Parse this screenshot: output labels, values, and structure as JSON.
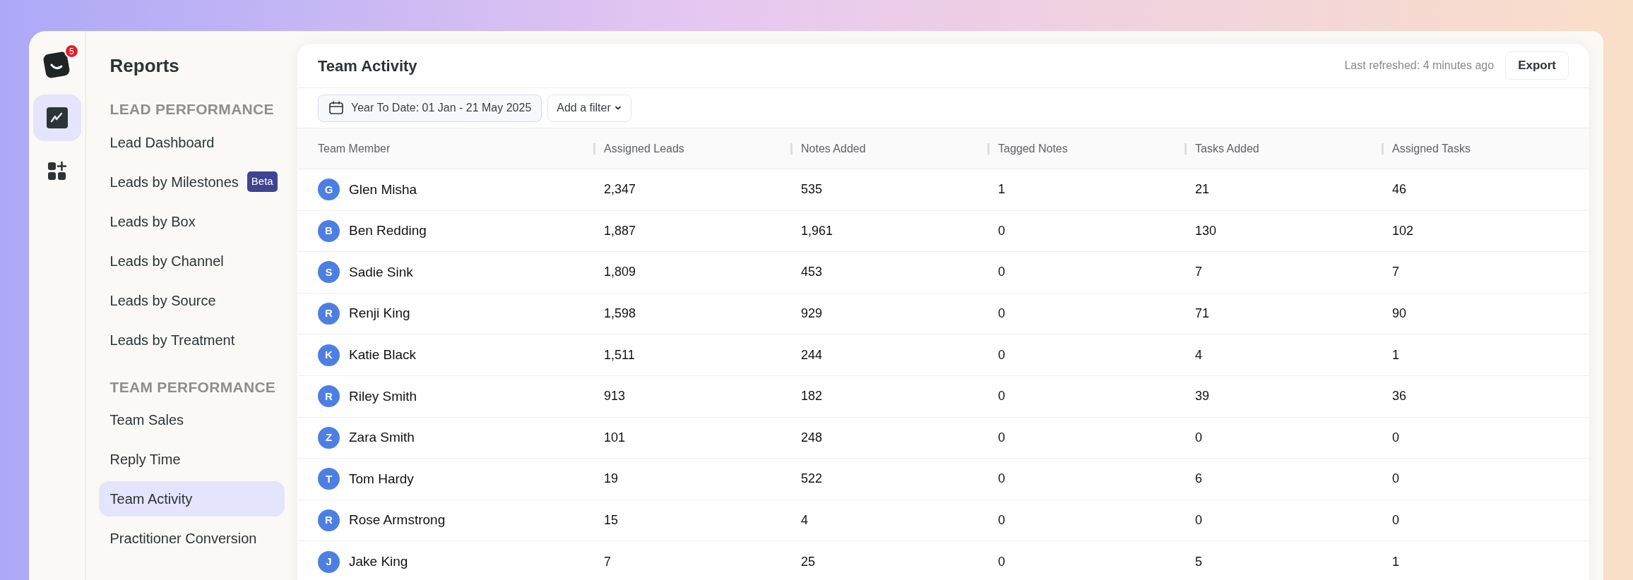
{
  "rail": {
    "logo_badge": "5",
    "items": [
      {
        "kind": "chart",
        "selected": true
      },
      {
        "kind": "apps",
        "selected": false
      }
    ]
  },
  "sidebar": {
    "title": "Reports",
    "sections": [
      {
        "heading": "LEAD PERFORMANCE",
        "items": [
          {
            "label": "Lead Dashboard",
            "selected": false
          },
          {
            "label": "Leads by Milestones",
            "badge": "Beta",
            "selected": false
          },
          {
            "label": "Leads by Box",
            "selected": false
          },
          {
            "label": "Leads by Channel",
            "selected": false
          },
          {
            "label": "Leads by Source",
            "selected": false
          },
          {
            "label": "Leads by Treatment",
            "selected": false
          }
        ]
      },
      {
        "heading": "TEAM PERFORMANCE",
        "items": [
          {
            "label": "Team Sales",
            "selected": false
          },
          {
            "label": "Reply Time",
            "selected": false
          },
          {
            "label": "Team Activity",
            "selected": true
          },
          {
            "label": "Practitioner Conversion",
            "selected": false
          }
        ]
      }
    ]
  },
  "report": {
    "title": "Team Activity",
    "last_refreshed": "Last refreshed: 4 minutes ago",
    "export_button": "Export",
    "date_filter": "Year To Date: 01 Jan - 21 May 2025",
    "add_filter": "Add a filter"
  },
  "table": {
    "columns": [
      "Team Member",
      "Assigned Leads",
      "Notes Added",
      "Tagged Notes",
      "Tasks Added",
      "Assigned Tasks"
    ],
    "rows": [
      {
        "initial": "G",
        "name": "Glen Misha",
        "values": [
          "2,347",
          "535",
          "1",
          "21",
          "46"
        ]
      },
      {
        "initial": "B",
        "name": "Ben Redding",
        "values": [
          "1,887",
          "1,961",
          "0",
          "130",
          "102"
        ]
      },
      {
        "initial": "S",
        "name": "Sadie Sink",
        "values": [
          "1,809",
          "453",
          "0",
          "7",
          "7"
        ]
      },
      {
        "initial": "R",
        "name": "Renji King",
        "values": [
          "1,598",
          "929",
          "0",
          "71",
          "90"
        ]
      },
      {
        "initial": "K",
        "name": "Katie Black",
        "values": [
          "1,511",
          "244",
          "0",
          "4",
          "1"
        ]
      },
      {
        "initial": "R",
        "name": "Riley Smith",
        "values": [
          "913",
          "182",
          "0",
          "39",
          "36"
        ]
      },
      {
        "initial": "Z",
        "name": "Zara Smith",
        "values": [
          "101",
          "248",
          "0",
          "0",
          "0"
        ]
      },
      {
        "initial": "T",
        "name": "Tom Hardy",
        "values": [
          "19",
          "522",
          "0",
          "6",
          "0"
        ]
      },
      {
        "initial": "R",
        "name": "Rose Armstrong",
        "values": [
          "15",
          "4",
          "0",
          "0",
          "0"
        ]
      },
      {
        "initial": "J",
        "name": "Jake King",
        "values": [
          "7",
          "25",
          "0",
          "5",
          "1"
        ]
      }
    ]
  }
}
